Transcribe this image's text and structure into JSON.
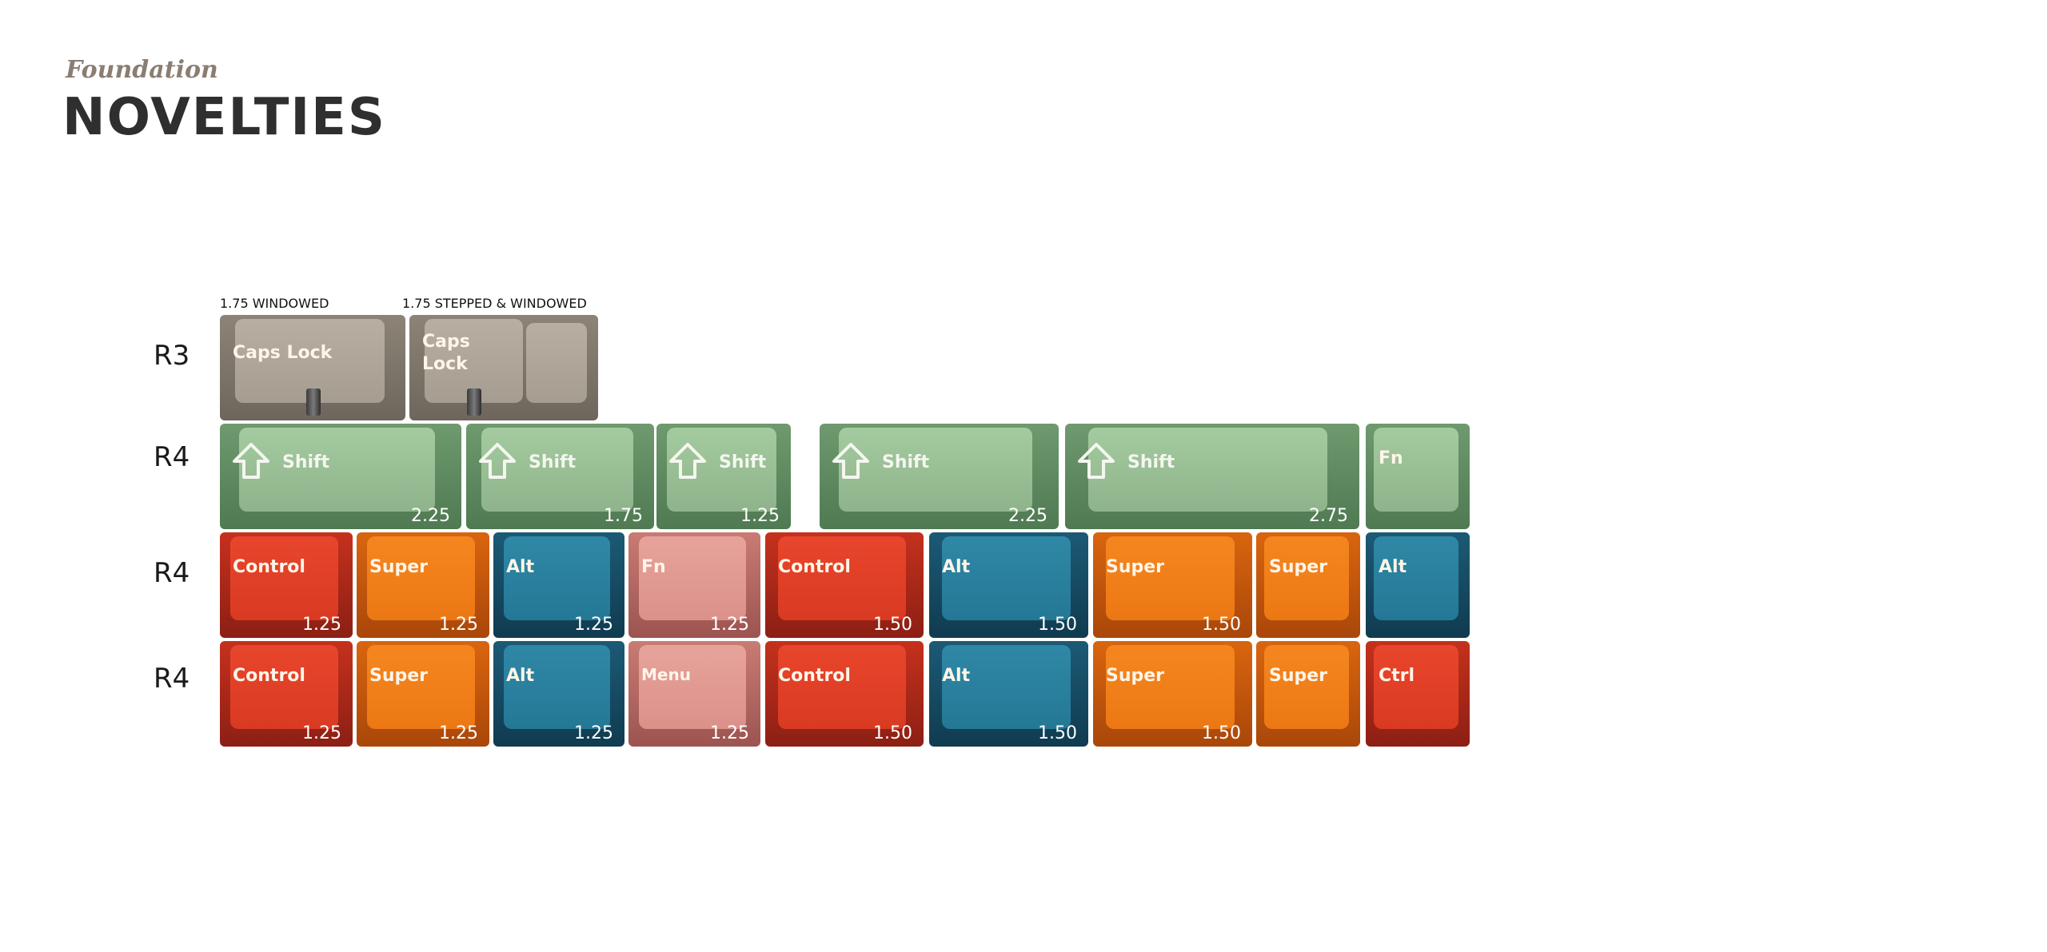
{
  "header": {
    "subtitle": "Foundation",
    "title": "NOVELTIES"
  },
  "captions": [
    "1.75 WINDOWED",
    "1.75 STEPPED & WINDOWED"
  ],
  "row_labels": [
    "R3",
    "R4",
    "R4",
    "R4"
  ],
  "rows": [
    [
      {
        "legend": "Caps Lock",
        "size": "",
        "color": "beige",
        "window": true
      },
      {
        "legend": "Caps\nLock",
        "size": "",
        "color": "beige",
        "window": true,
        "stepped": true
      }
    ],
    [
      {
        "legend": "Shift",
        "size": "2.25",
        "color": "green",
        "arrow": true
      },
      {
        "legend": "Shift",
        "size": "1.75",
        "color": "green",
        "arrow": true
      },
      {
        "legend": "Shift",
        "size": "1.25",
        "color": "green",
        "arrow": true
      },
      {
        "legend": "Shift",
        "size": "2.25",
        "color": "green",
        "arrow": true
      },
      {
        "legend": "Shift",
        "size": "2.75",
        "color": "green",
        "arrow": true
      },
      {
        "legend": "Fn",
        "size": "",
        "color": "green"
      }
    ],
    [
      {
        "legend": "Control",
        "size": "1.25",
        "color": "red"
      },
      {
        "legend": "Super",
        "size": "1.25",
        "color": "orange"
      },
      {
        "legend": "Alt",
        "size": "1.25",
        "color": "teal"
      },
      {
        "legend": "Fn",
        "size": "1.25",
        "color": "pink"
      },
      {
        "legend": "Control",
        "size": "1.50",
        "color": "red"
      },
      {
        "legend": "Alt",
        "size": "1.50",
        "color": "teal"
      },
      {
        "legend": "Super",
        "size": "1.50",
        "color": "orange"
      },
      {
        "legend": "Super",
        "size": "",
        "color": "orange"
      },
      {
        "legend": "Alt",
        "size": "",
        "color": "teal"
      }
    ],
    [
      {
        "legend": "Control",
        "size": "1.25",
        "color": "red"
      },
      {
        "legend": "Super",
        "size": "1.25",
        "color": "orange"
      },
      {
        "legend": "Alt",
        "size": "1.25",
        "color": "teal"
      },
      {
        "legend": "Menu",
        "size": "1.25",
        "color": "pink"
      },
      {
        "legend": "Control",
        "size": "1.50",
        "color": "red"
      },
      {
        "legend": "Alt",
        "size": "1.50",
        "color": "teal"
      },
      {
        "legend": "Super",
        "size": "1.50",
        "color": "orange"
      },
      {
        "legend": "Super",
        "size": "",
        "color": "orange"
      },
      {
        "legend": "Ctrl",
        "size": "",
        "color": "red"
      }
    ]
  ]
}
